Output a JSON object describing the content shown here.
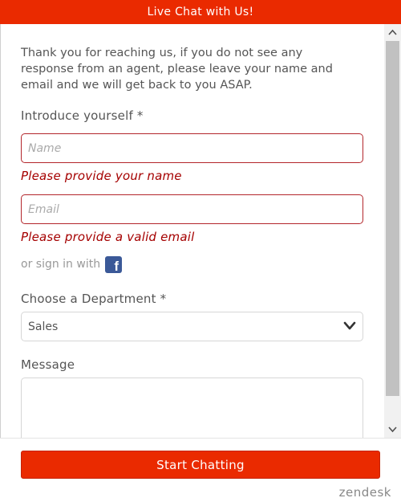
{
  "header": {
    "title": "Live Chat with Us!"
  },
  "form": {
    "intro": "Thank you for reaching us, if you do not see any response from an agent, please leave your name and email and we will get back to you ASAP.",
    "introduce_label": "Introduce yourself *",
    "name_placeholder": "Name",
    "name_value": "",
    "name_error": "Please provide your name",
    "email_placeholder": "Email",
    "email_value": "",
    "email_error": "Please provide a valid email",
    "signin_text": "or sign in with",
    "signin_icon": "facebook-icon",
    "department_label": "Choose a Department *",
    "department_selected": "Sales",
    "message_label": "Message",
    "message_value": ""
  },
  "footer": {
    "start_label": "Start Chatting",
    "brand": "zendesk"
  },
  "colors": {
    "accent": "#ea2a00",
    "error": "#a50000",
    "facebook": "#3b5998"
  }
}
